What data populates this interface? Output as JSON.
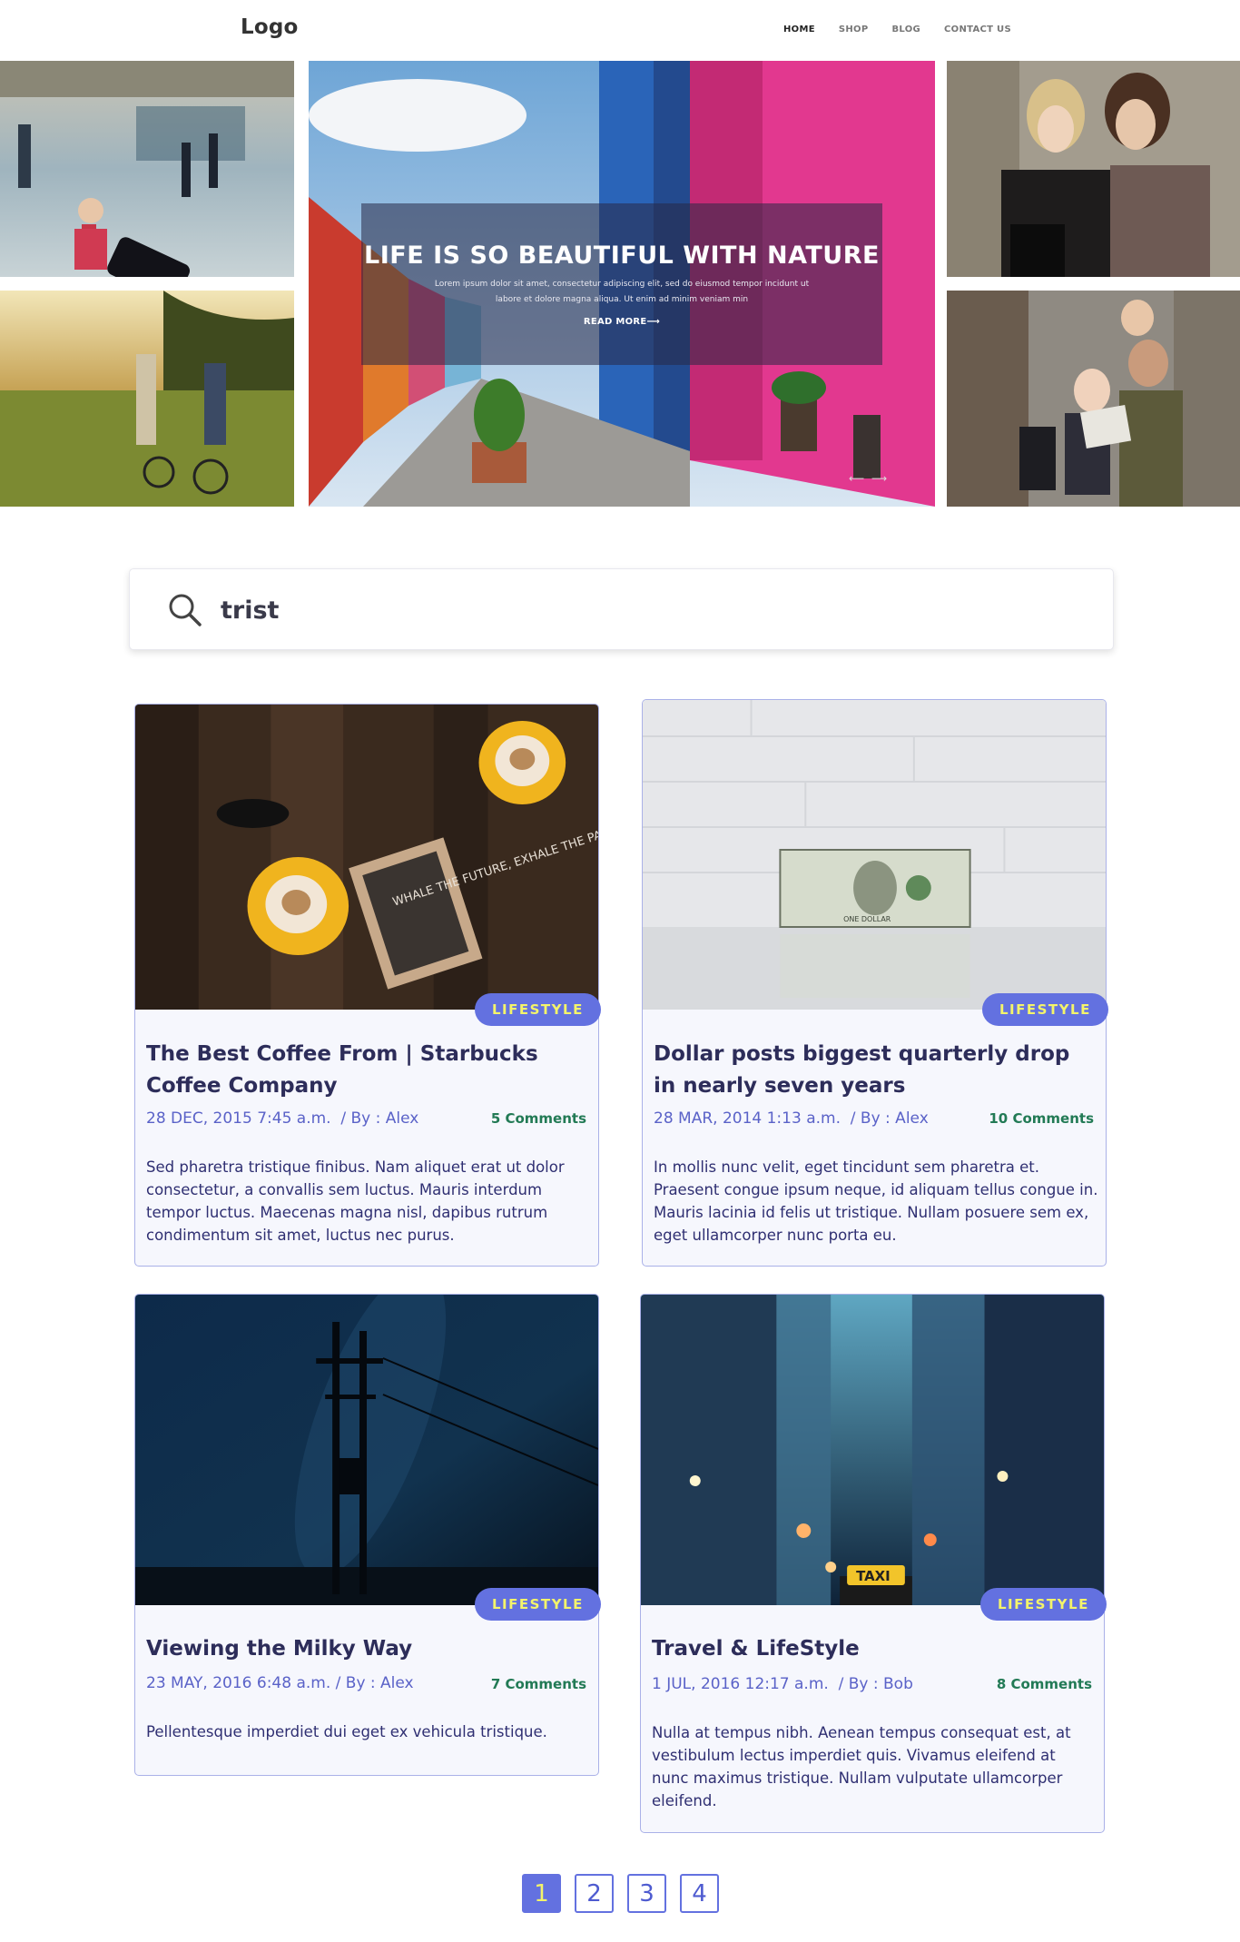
{
  "header": {
    "logo": "Logo",
    "nav": [
      "HOME",
      "SHOP",
      "BLOG",
      "CONTACT US"
    ]
  },
  "hero": {
    "title": "LIFE IS SO BEAUTIFUL WITH NATURE",
    "text": "Lorem ipsum dolor sit amet, consectetur adipiscing elit, sed do eiusmod tempor incidunt ut labore et dolore magna aliqua. Ut enim ad minim veniam min",
    "link": "READ MORE⟶",
    "arrows": "⟵ ⟶"
  },
  "search": {
    "value": "trist"
  },
  "posts": [
    {
      "category": "LIFESTYLE",
      "title": "The Best Coffee From | Starbucks Coffee Company",
      "date": "28 DEC, 2015 7:45 a.m.",
      "author": "/ By : Alex",
      "comments": "5 Comments",
      "body": "Sed pharetra tristique finibus. Nam aliquet erat ut dolor consectetur, a convallis sem luctus. Mauris interdum tempor luctus. Maecenas magna nisl, dapibus rutrum condimentum sit amet, luctus nec purus.",
      "image_text": "WHALE THE FUTURE, EXHALE THE PAST."
    },
    {
      "category": "LIFESTYLE",
      "title": "Dollar posts biggest quarterly drop in nearly seven years",
      "date": "28 MAR, 2014 1:13 a.m.",
      "author": "/ By : Alex",
      "comments": "10 Comments",
      "body": "In mollis nunc velit, eget tincidunt sem pharetra et. Praesent congue ipsum neque, id aliquam tellus congue in. Mauris lacinia id felis ut tristique. Nullam posuere sem ex, eget ullamcorper nunc porta eu.",
      "image_text": "ONE DOLLAR"
    },
    {
      "category": "LIFESTYLE",
      "title": "Viewing the Milky Way",
      "date": "23 MAY, 2016 6:48 a.m.",
      "author": "/ By : Alex",
      "comments": "7 Comments",
      "body": "Pellentesque imperdiet dui eget ex vehicula tristique."
    },
    {
      "category": "LIFESTYLE",
      "title": "Travel & LifeStyle",
      "date": "1 JUL, 2016 12:17 a.m.",
      "author": "/ By : Bob",
      "comments": "8 Comments",
      "body": "Nulla at tempus nibh. Aenean tempus consequat est, at vestibulum lectus imperdiet quis. Vivamus eleifend at nunc maximus tristique. Nullam vulputate ullamcorper eleifend.",
      "image_text": "TAXI"
    }
  ],
  "pagination": [
    "1",
    "2",
    "3",
    "4"
  ],
  "colors": {
    "accent": "#6371e0",
    "badge_text": "#f4f46a",
    "comments": "#227a55",
    "meta": "#5a62c8"
  }
}
